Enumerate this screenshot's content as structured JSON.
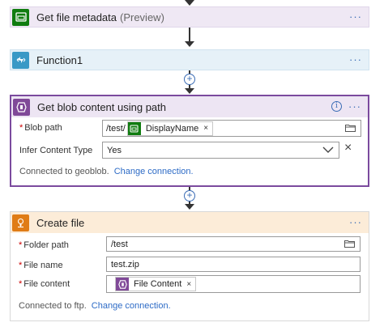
{
  "steps": {
    "metadata": {
      "title": "Get file metadata",
      "badge": "(Preview)",
      "menu": "···",
      "icon": "file-metadata-icon"
    },
    "function1": {
      "title": "Function1",
      "menu": "···",
      "icon": "lightning-icon"
    },
    "blob": {
      "title": "Get blob content using path",
      "menu": "···",
      "info_icon": "i",
      "fields": {
        "blob_path_label": "Blob path",
        "blob_path_prefix": "/test/",
        "blob_path_token": "DisplayName",
        "token_remove": "×",
        "infer_label": "Infer Content Type",
        "infer_value": "Yes"
      },
      "connected_text": "Connected to geoblob.",
      "change_connection": "Change connection."
    },
    "createfile": {
      "title": "Create file",
      "menu": "···",
      "fields": {
        "folder_label": "Folder path",
        "folder_value": "/test",
        "filename_label": "File name",
        "filename_value": "test.zip",
        "content_label": "File content",
        "content_token": "File Content",
        "token_remove": "×"
      },
      "connected_text": "Connected to ftp.",
      "change_connection": "Change connection."
    }
  },
  "required_marker": "*",
  "plus_symbol": "+",
  "close_symbol": "×",
  "colors": {
    "metadata_bg": "#efe8f4",
    "metadata_icon": "#107c10",
    "function_bg": "#e6f1f8",
    "function_icon": "#3999c6",
    "blob_bg": "#ede5f3",
    "blob_border": "#7b4a9e",
    "blob_icon": "#804998",
    "createfile_bg": "#fcecd8",
    "createfile_icon": "#e07c16"
  }
}
